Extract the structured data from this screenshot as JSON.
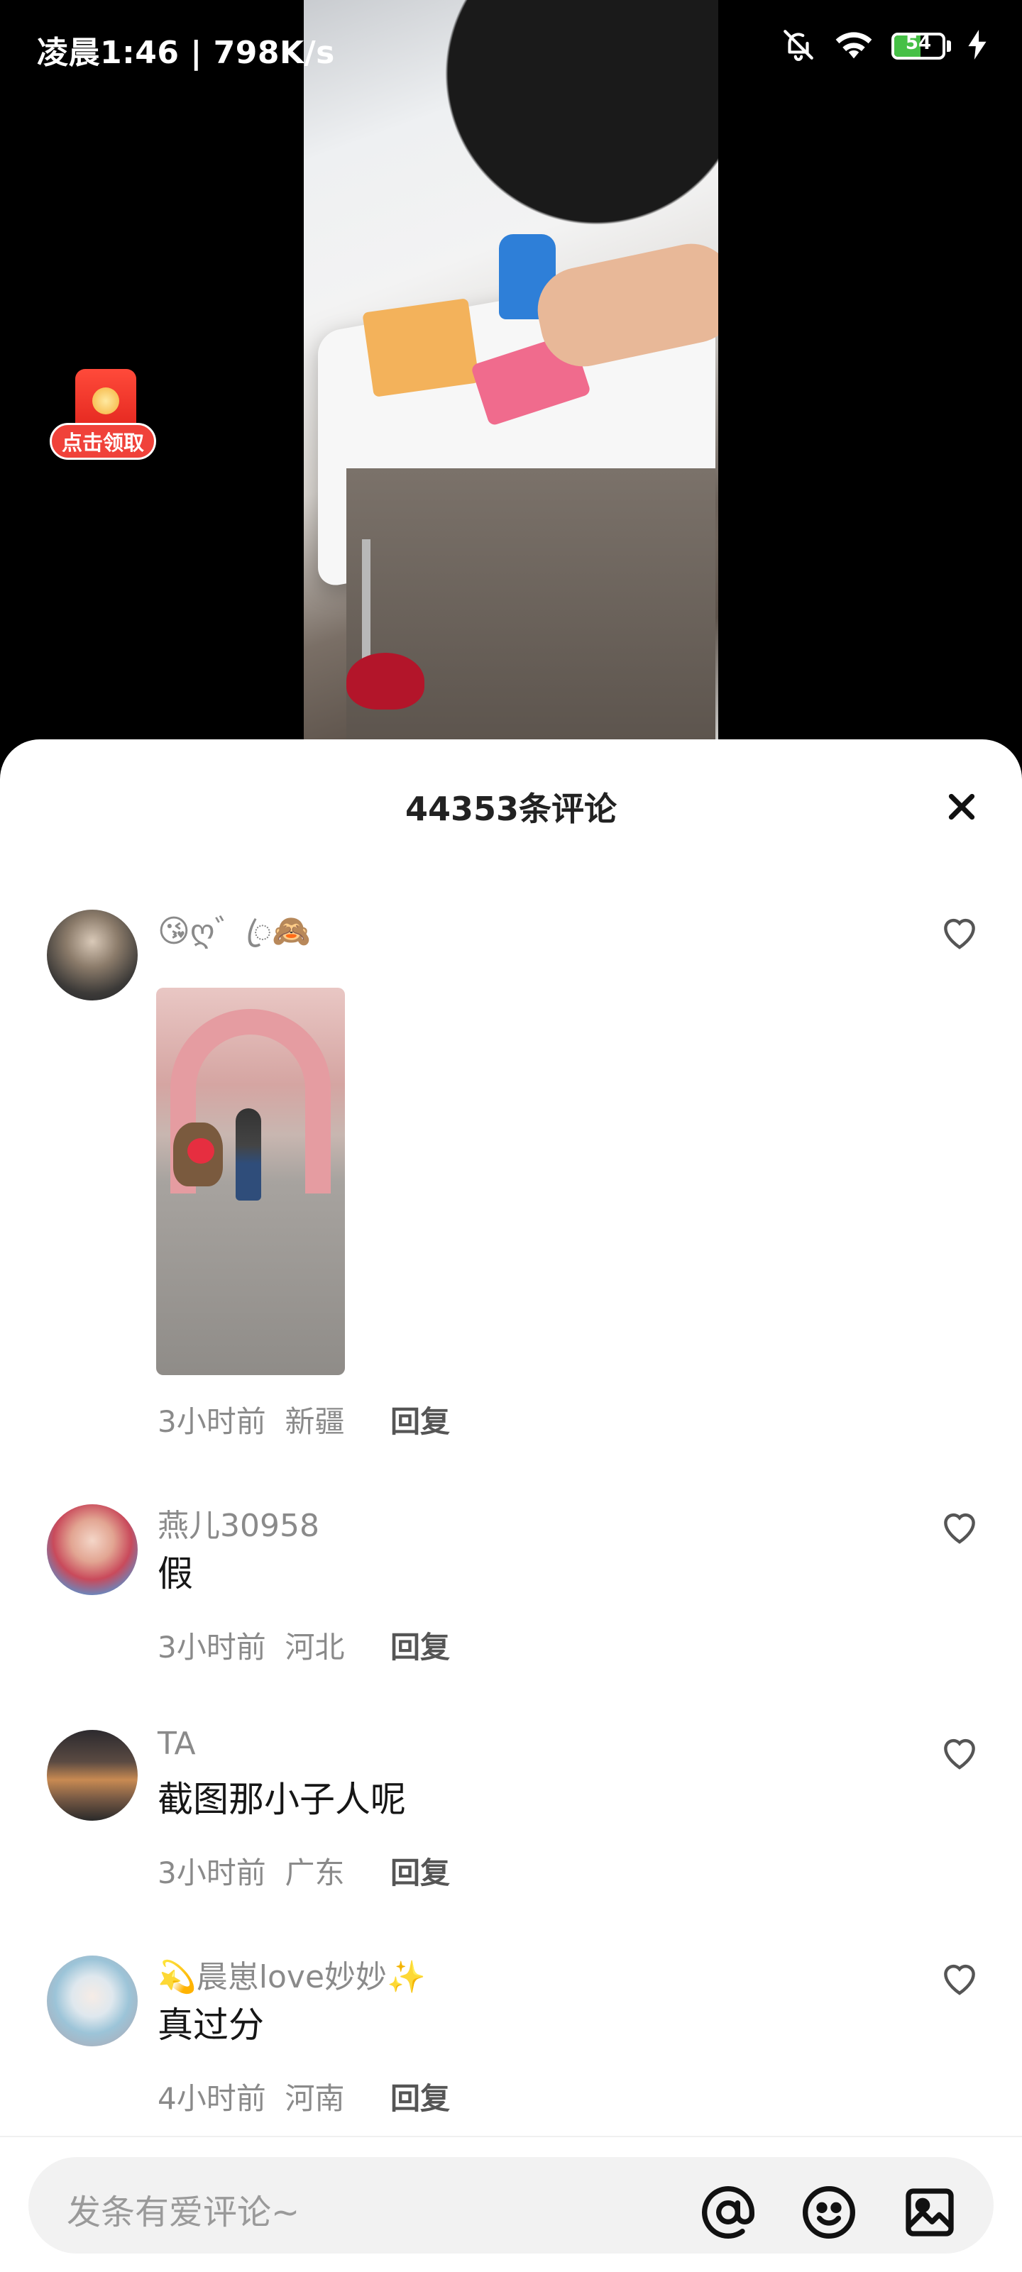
{
  "status_bar": {
    "time": "凌晨1:46 | 798K/s",
    "battery": "54",
    "battery_fraction": 0.54,
    "icons": [
      "bell-off-icon",
      "wifi-icon",
      "battery-icon",
      "charging-icon"
    ]
  },
  "red_packet": {
    "label": "点击领取"
  },
  "comments_sheet": {
    "title": "44353条评论",
    "close_icon": "close-icon",
    "comments": [
      {
        "username": "😘ღ゛ꦿ🙈",
        "text": "",
        "time": "3小时前",
        "location": "新疆",
        "reply": "回复",
        "has_image": true
      },
      {
        "username": "燕儿30958",
        "text": "假",
        "time": "3小时前",
        "location": "河北",
        "reply": "回复"
      },
      {
        "username": "TA",
        "text": "截图那小子人呢",
        "time": "3小时前",
        "location": "广东",
        "reply": "回复"
      },
      {
        "username": "💫晨崽love妙妙✨",
        "text": "真过分",
        "time": "4小时前",
        "location": "河南",
        "reply": "回复"
      }
    ]
  },
  "input_bar": {
    "placeholder": "发条有爱评论~",
    "icons": [
      "at-icon",
      "emoji-icon",
      "image-icon"
    ]
  },
  "colors": {
    "red_packet": "#e0231c",
    "battery_fill": "#46c046"
  }
}
